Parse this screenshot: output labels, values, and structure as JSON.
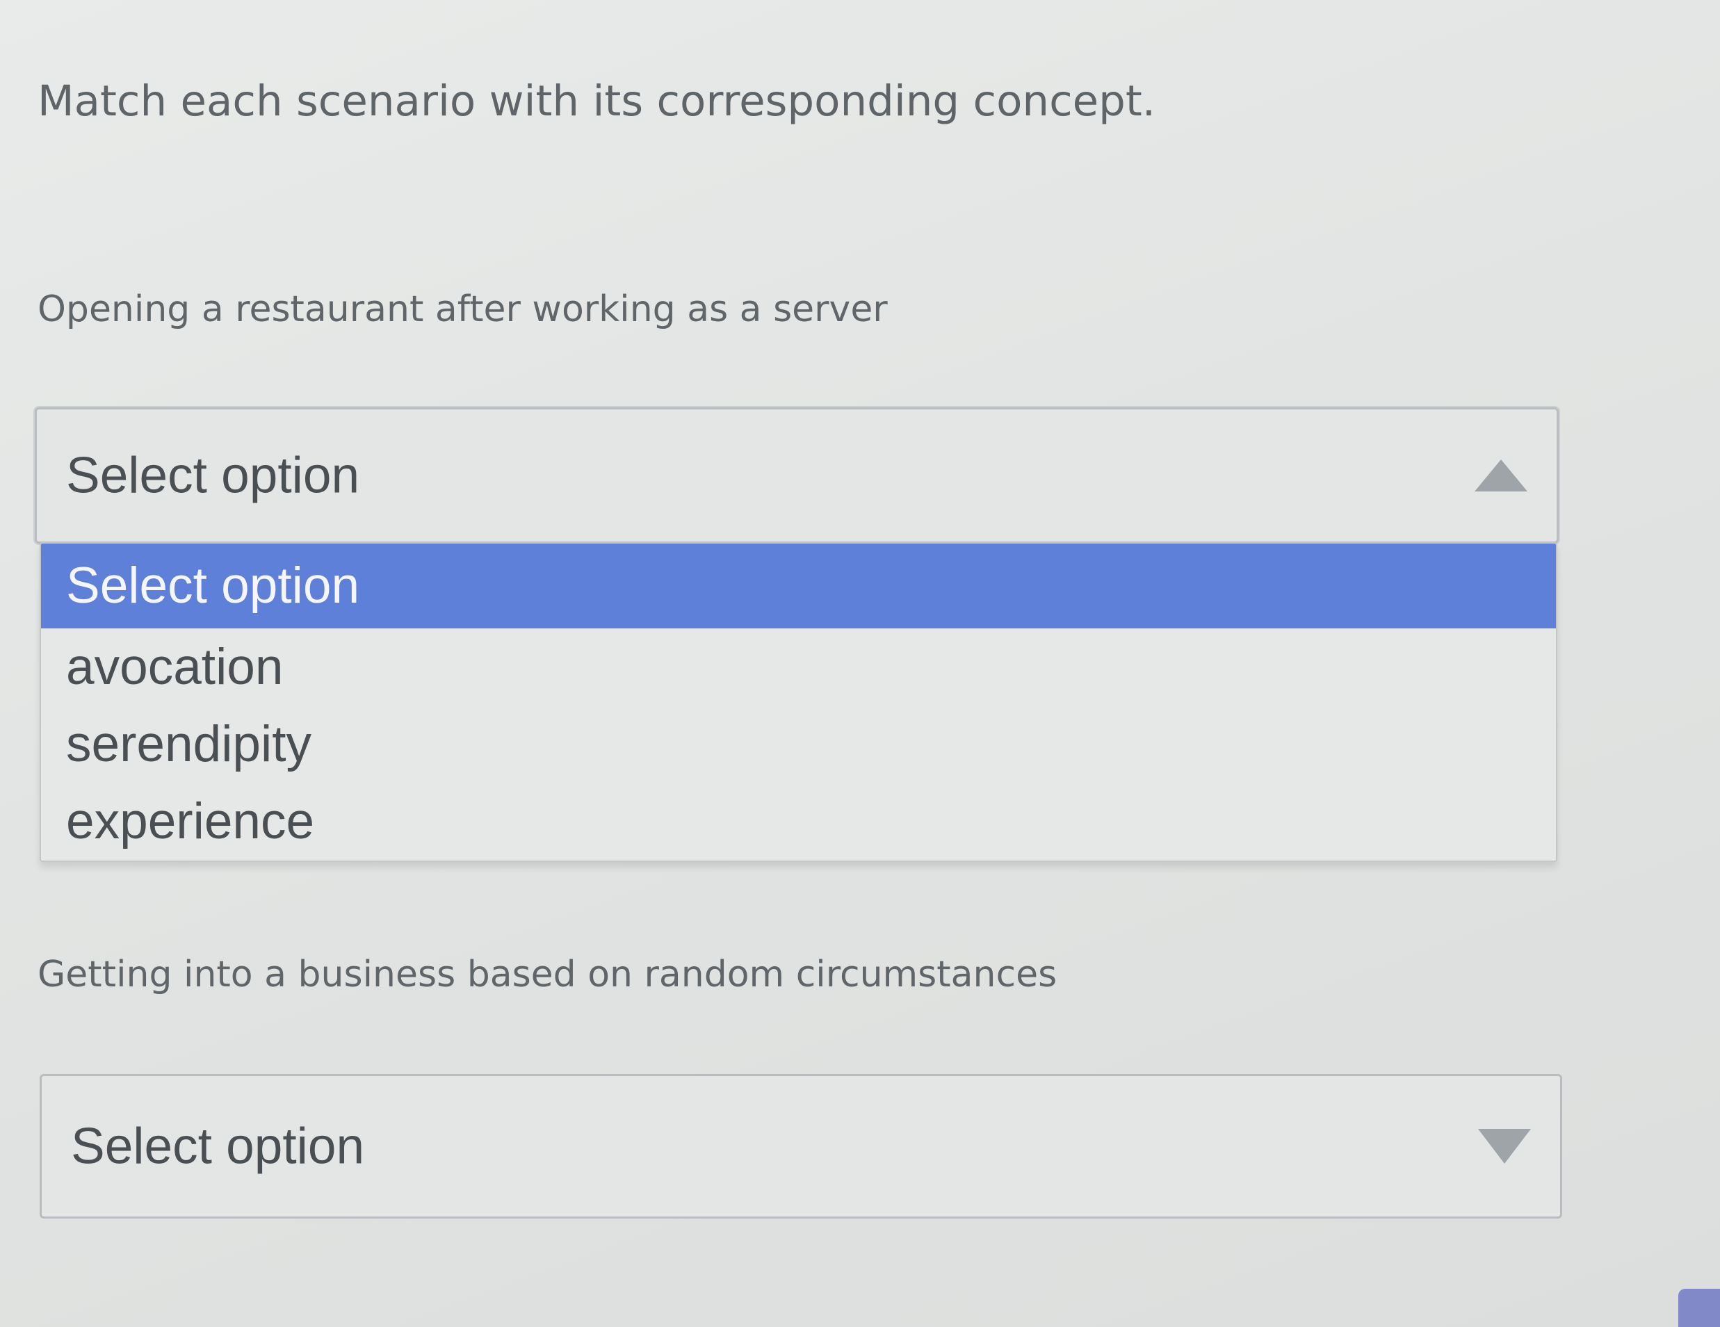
{
  "instruction": "Match each scenario with its corresponding concept.",
  "questions": [
    {
      "scenario": "Opening a restaurant after working as a server",
      "select": {
        "value": "Select option",
        "expanded": true,
        "caret_icon": "caret-up-icon"
      }
    },
    {
      "scenario": "Getting into a business based on random circumstances",
      "select": {
        "value": "Select option",
        "expanded": false,
        "caret_icon": "caret-down-icon"
      }
    }
  ],
  "options": [
    "Select option",
    "avocation",
    "serendipity",
    "experience"
  ],
  "highlighted_option": "Select option",
  "colors": {
    "highlight": "#5f80d8",
    "text": "#4a4f53",
    "muted_text": "#5f6569"
  }
}
